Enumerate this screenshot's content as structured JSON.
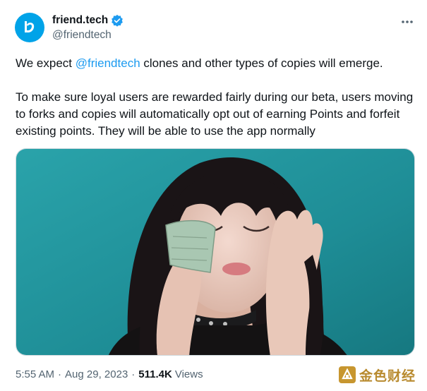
{
  "header": {
    "display_name": "friend.tech",
    "handle": "@friendtech",
    "verified": true,
    "avatar_color": "#00a3e8",
    "icons": [
      "friendtech-logo-icon",
      "verified-badge-icon",
      "more-options-icon"
    ]
  },
  "tweet": {
    "line1_before": "We expect ",
    "line1_mention": "@friendtech",
    "line1_after": " clones and other types of copies will emerge.",
    "paragraph2": "To make sure loyal users are rewarded fairly during our beta, users moving to forks and copies will automatically opt out of earning Points and forfeit existing points. They will be able to use the app normally",
    "mention_color": "#1d9bf0"
  },
  "media": {
    "type": "photo",
    "background_color": "#1f8f98"
  },
  "meta": {
    "time": "5:55 AM",
    "separator": "·",
    "date": "Aug 29, 2023",
    "views_count": "511.4K",
    "views_label": "Views"
  },
  "watermark": {
    "text": "金色财经",
    "color": "#b88a2e"
  }
}
